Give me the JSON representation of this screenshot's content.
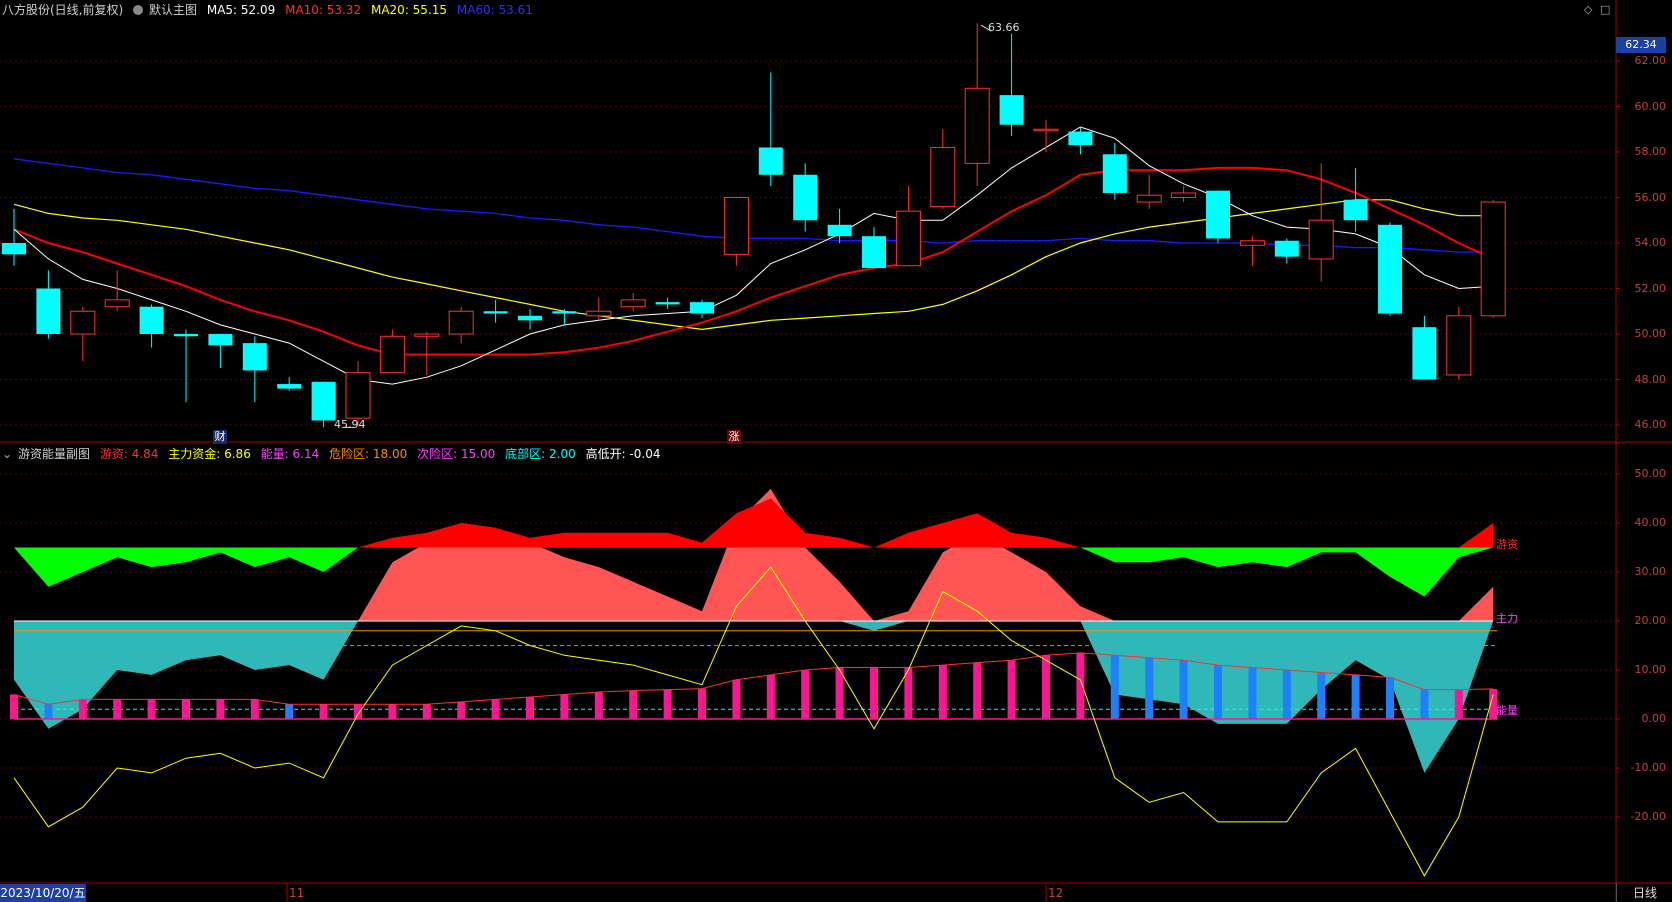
{
  "main_header": {
    "stock_title": "八方股份(日线,前复权)",
    "indicator_name": "默认主图",
    "ma5": "MA5: 52.09",
    "ma10": "MA10: 53.32",
    "ma20": "MA20: 55.15",
    "ma60": "MA60: 53.61"
  },
  "sub_header": {
    "indicator_name": "游资能量副图",
    "youzi": "游资: 4.84",
    "zhuli": "主力资金: 6.86",
    "nengliang": "能量: 6.14",
    "weixian": "危险区: 18.00",
    "cixian": "次险区: 15.00",
    "dibu": "底部区: 2.00",
    "gaodikai": "高低开: -0.04"
  },
  "colors": {
    "up": "#ff3030",
    "down": "#00ffff",
    "ma5": "#ffffff",
    "ma10": "#ff0000",
    "ma20": "#ffff00",
    "ma60": "#1a1aff",
    "axis": "#aa0000",
    "youzi_pos": "#ff0000",
    "youzi_neg": "#00ff00",
    "zhuli_pos": "#ff5555",
    "zhuli_neg": "#30b8b8",
    "energy_pos": "#ff1493",
    "energy_neg": "#1e7fff"
  },
  "price_axis": [
    "62.00",
    "60.00",
    "58.00",
    "56.00",
    "54.00",
    "52.00",
    "50.00",
    "48.00",
    "46.00"
  ],
  "sub_axis": [
    "50.00",
    "40.00",
    "30.00",
    "20.00",
    "10.00",
    "0.00",
    "-10.00",
    "-20.00"
  ],
  "current_price_tag": "62.34",
  "annotations": {
    "high_label": "63.66",
    "low_label": "45.94",
    "marker_cai": "财",
    "marker_zhang": "涨"
  },
  "sub_right_labels": {
    "youzi": "游资",
    "zhuli": "主力",
    "nengliang": "能量"
  },
  "date_bar": {
    "current_date": "2023/10/20/五",
    "month_11": "11",
    "month_12": "12",
    "period_button": "日线"
  },
  "chart_data": [
    {
      "type": "candlestick",
      "title": "八方股份(日线,前复权)",
      "ylim": [
        45,
        63
      ],
      "candles": [
        {
          "o": 54.0,
          "h": 55.5,
          "l": 53.0,
          "c": 53.5
        },
        {
          "o": 52.0,
          "h": 52.8,
          "l": 49.8,
          "c": 50.0
        },
        {
          "o": 50.0,
          "h": 51.2,
          "l": 48.8,
          "c": 51.0
        },
        {
          "o": 51.2,
          "h": 52.8,
          "l": 51.0,
          "c": 51.5
        },
        {
          "o": 51.2,
          "h": 51.3,
          "l": 49.4,
          "c": 50.0
        },
        {
          "o": 50.0,
          "h": 50.2,
          "l": 47.0,
          "c": 49.9
        },
        {
          "o": 50.0,
          "h": 50.0,
          "l": 48.5,
          "c": 49.5
        },
        {
          "o": 49.6,
          "h": 49.9,
          "l": 47.0,
          "c": 48.4
        },
        {
          "o": 47.8,
          "h": 48.1,
          "l": 47.5,
          "c": 47.6
        },
        {
          "o": 47.9,
          "h": 47.9,
          "l": 45.9,
          "c": 46.2
        },
        {
          "o": 46.3,
          "h": 48.8,
          "l": 45.94,
          "c": 48.3
        },
        {
          "o": 48.3,
          "h": 50.2,
          "l": 48.3,
          "c": 49.9
        },
        {
          "o": 49.9,
          "h": 50.1,
          "l": 48.2,
          "c": 50.0
        },
        {
          "o": 50.0,
          "h": 51.2,
          "l": 49.6,
          "c": 51.0
        },
        {
          "o": 51.0,
          "h": 51.5,
          "l": 50.5,
          "c": 50.9
        },
        {
          "o": 50.8,
          "h": 51.1,
          "l": 50.2,
          "c": 50.6
        },
        {
          "o": 51.0,
          "h": 51.1,
          "l": 50.4,
          "c": 50.9
        },
        {
          "o": 50.8,
          "h": 51.6,
          "l": 50.6,
          "c": 51.0
        },
        {
          "o": 51.2,
          "h": 51.8,
          "l": 51.0,
          "c": 51.5
        },
        {
          "o": 51.4,
          "h": 51.6,
          "l": 51.1,
          "c": 51.3
        },
        {
          "o": 51.4,
          "h": 51.5,
          "l": 50.7,
          "c": 50.9
        },
        {
          "o": 53.5,
          "h": 56.0,
          "l": 53.0,
          "c": 56.0
        },
        {
          "o": 58.2,
          "h": 61.5,
          "l": 56.5,
          "c": 57.0
        },
        {
          "o": 57.0,
          "h": 57.5,
          "l": 54.5,
          "c": 55.0
        },
        {
          "o": 54.8,
          "h": 55.5,
          "l": 54.0,
          "c": 54.3
        },
        {
          "o": 54.3,
          "h": 54.7,
          "l": 53.2,
          "c": 52.9
        },
        {
          "o": 53.0,
          "h": 56.5,
          "l": 53.0,
          "c": 55.4
        },
        {
          "o": 55.6,
          "h": 59.0,
          "l": 55.5,
          "c": 58.2
        },
        {
          "o": 57.5,
          "h": 63.66,
          "l": 56.5,
          "c": 60.8
        },
        {
          "o": 60.5,
          "h": 63.2,
          "l": 58.7,
          "c": 59.2
        },
        {
          "o": 59.0,
          "h": 59.4,
          "l": 58.0,
          "c": 59.0
        },
        {
          "o": 58.9,
          "h": 59.1,
          "l": 57.9,
          "c": 58.3
        },
        {
          "o": 57.9,
          "h": 58.4,
          "l": 55.9,
          "c": 56.2
        },
        {
          "o": 55.8,
          "h": 57.0,
          "l": 55.5,
          "c": 56.1
        },
        {
          "o": 56.0,
          "h": 56.5,
          "l": 55.8,
          "c": 56.2
        },
        {
          "o": 56.3,
          "h": 56.3,
          "l": 54.0,
          "c": 54.2
        },
        {
          "o": 53.9,
          "h": 54.3,
          "l": 53.0,
          "c": 54.1
        },
        {
          "o": 54.1,
          "h": 54.2,
          "l": 53.1,
          "c": 53.4
        },
        {
          "o": 53.3,
          "h": 57.5,
          "l": 52.3,
          "c": 55.0
        },
        {
          "o": 55.9,
          "h": 57.3,
          "l": 54.5,
          "c": 55.0
        },
        {
          "o": 54.8,
          "h": 54.9,
          "l": 50.8,
          "c": 50.9
        },
        {
          "o": 50.3,
          "h": 50.8,
          "l": 48.0,
          "c": 48.0
        },
        {
          "o": 48.2,
          "h": 51.2,
          "l": 48.0,
          "c": 50.8
        },
        {
          "o": 50.8,
          "h": 55.9,
          "l": 50.7,
          "c": 55.8
        }
      ],
      "ma5": [
        54.6,
        53.3,
        52.4,
        52.0,
        51.5,
        51.0,
        50.4,
        50.0,
        49.6,
        48.8,
        48.0,
        47.8,
        48.1,
        48.6,
        49.3,
        50.0,
        50.4,
        50.6,
        50.8,
        50.9,
        51.0,
        51.7,
        53.1,
        53.7,
        54.4,
        55.3,
        55.0,
        55.0,
        56.1,
        57.3,
        58.2,
        59.1,
        58.6,
        57.4,
        56.6,
        56.0,
        55.2,
        54.7,
        54.6,
        54.4,
        53.8,
        52.6,
        52.0,
        52.1
      ],
      "ma10": [
        54.6,
        54.0,
        53.6,
        53.1,
        52.6,
        52.1,
        51.5,
        51.0,
        50.6,
        50.1,
        49.5,
        49.1,
        49.1,
        49.1,
        49.1,
        49.1,
        49.2,
        49.4,
        49.7,
        50.1,
        50.5,
        51.0,
        51.6,
        52.1,
        52.6,
        52.9,
        53.1,
        53.6,
        54.5,
        55.4,
        56.1,
        57.0,
        57.2,
        57.2,
        57.2,
        57.3,
        57.3,
        57.2,
        56.8,
        56.2,
        55.5,
        54.8,
        54.0,
        53.3
      ],
      "ma20": [
        55.7,
        55.3,
        55.1,
        55.0,
        54.8,
        54.6,
        54.3,
        54.0,
        53.7,
        53.3,
        52.9,
        52.5,
        52.2,
        51.9,
        51.6,
        51.3,
        51.0,
        50.8,
        50.6,
        50.4,
        50.2,
        50.4,
        50.6,
        50.7,
        50.8,
        50.9,
        51.0,
        51.3,
        51.9,
        52.6,
        53.4,
        54.0,
        54.4,
        54.7,
        54.9,
        55.1,
        55.3,
        55.5,
        55.7,
        55.9,
        55.9,
        55.5,
        55.2,
        55.2
      ],
      "ma60": [
        57.7,
        57.5,
        57.3,
        57.1,
        57.0,
        56.8,
        56.6,
        56.4,
        56.3,
        56.1,
        55.9,
        55.7,
        55.5,
        55.4,
        55.3,
        55.1,
        55.0,
        54.8,
        54.7,
        54.5,
        54.3,
        54.2,
        54.2,
        54.2,
        54.1,
        54.1,
        54.1,
        54.0,
        54.1,
        54.1,
        54.1,
        54.2,
        54.1,
        54.1,
        54.0,
        54.0,
        54.0,
        53.9,
        53.9,
        53.8,
        53.8,
        53.7,
        53.6,
        53.6
      ]
    },
    {
      "type": "area",
      "title": "游资能量副图",
      "ylim": [
        -28,
        55
      ],
      "levels": {
        "weixian": 18.0,
        "cixian": 15.0,
        "dibu": 2.0
      },
      "youzi": [
        35,
        27,
        30,
        33,
        31,
        32,
        34,
        31,
        33,
        30,
        35,
        37,
        38,
        40,
        39,
        37,
        38,
        38,
        38,
        38,
        36,
        42,
        45,
        38,
        37,
        35,
        38,
        40,
        42,
        38,
        37,
        35,
        32,
        32,
        33,
        31,
        32,
        31,
        34,
        34,
        29,
        25,
        33,
        40
      ],
      "zhuli": [
        8,
        -2,
        2,
        10,
        9,
        12,
        13,
        10,
        11,
        8,
        20,
        32,
        36,
        40,
        39,
        36,
        33,
        31,
        28,
        25,
        22,
        40,
        47,
        35,
        28,
        18,
        22,
        34,
        38,
        34,
        30,
        23,
        5,
        4,
        3,
        -1,
        -1,
        -1,
        6,
        12,
        8,
        -11,
        0,
        27
      ],
      "yellow": [
        -12,
        -22,
        -18,
        -10,
        -11,
        -8,
        -7,
        -10,
        -9,
        -12,
        1,
        11,
        15,
        19,
        18,
        15,
        13,
        12,
        11,
        9,
        7,
        23,
        31,
        20,
        10,
        -2,
        10,
        26,
        22,
        16,
        12,
        8,
        -12,
        -17,
        -15,
        -21,
        -21,
        -21,
        -11,
        -6,
        -19,
        -32,
        -20,
        5
      ],
      "energy": [
        5,
        3,
        4,
        4,
        4,
        4,
        4,
        4,
        3,
        3,
        3,
        3,
        3,
        3.5,
        4,
        4.5,
        5,
        5.5,
        5.8,
        6,
        6.2,
        8,
        9,
        10,
        10.5,
        10.5,
        10.5,
        11,
        11.5,
        12,
        13,
        13.5,
        13,
        12.5,
        12,
        11,
        10.5,
        10,
        9.5,
        9,
        8.5,
        6,
        6,
        6.14
      ]
    }
  ]
}
